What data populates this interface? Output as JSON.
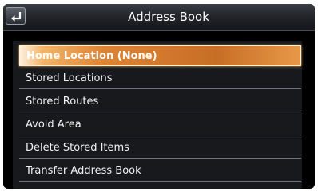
{
  "header": {
    "title": "Address Book",
    "back_icon": "back-arrow-icon"
  },
  "menu": {
    "items": [
      {
        "label": "Home Location (None)",
        "selected": true
      },
      {
        "label": "Stored Locations",
        "selected": false
      },
      {
        "label": "Stored Routes",
        "selected": false
      },
      {
        "label": "Avoid Area",
        "selected": false
      },
      {
        "label": "Delete Stored Items",
        "selected": false
      },
      {
        "label": "Transfer Address Book",
        "selected": false
      }
    ]
  },
  "colors": {
    "screen_bg": "#000000",
    "highlight": "#dc8434",
    "text": "#ffffff"
  }
}
